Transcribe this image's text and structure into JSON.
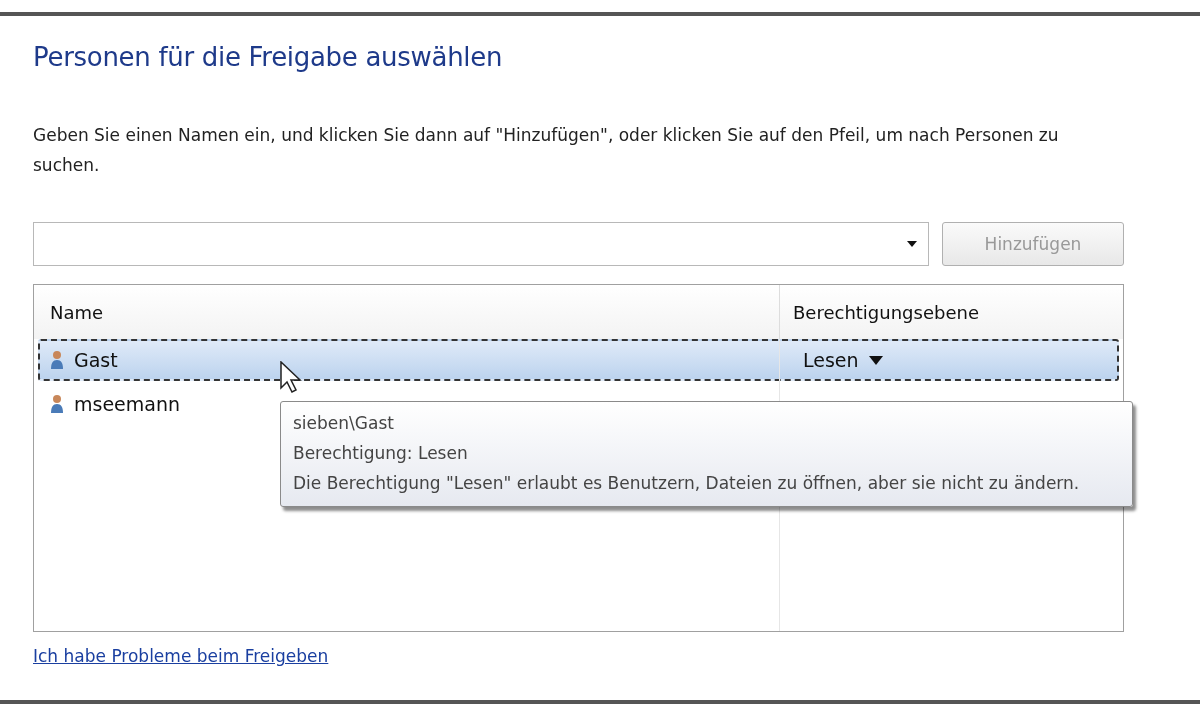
{
  "title": "Personen für die Freigabe auswählen",
  "instruction": "Geben Sie einen Namen ein, und klicken Sie dann auf \"Hinzufügen\", oder klicken Sie auf den Pfeil, um nach Personen zu suchen.",
  "add_button": {
    "label": "Hinzufügen",
    "disabled": true
  },
  "table": {
    "columns": [
      "Name",
      "Berechtigungsebene"
    ],
    "rows": [
      {
        "name": "Gast",
        "permission": "Lesen",
        "selected": true
      },
      {
        "name": "mseemann",
        "selected": false
      }
    ]
  },
  "tooltip": {
    "lines": [
      "sieben\\Gast",
      "Berechtigung: Lesen",
      "Die Berechtigung \"Lesen\" erlaubt es Benutzern, Dateien zu öffnen, aber sie nicht zu ändern."
    ]
  },
  "help_link": "Ich habe Probleme beim Freigeben"
}
